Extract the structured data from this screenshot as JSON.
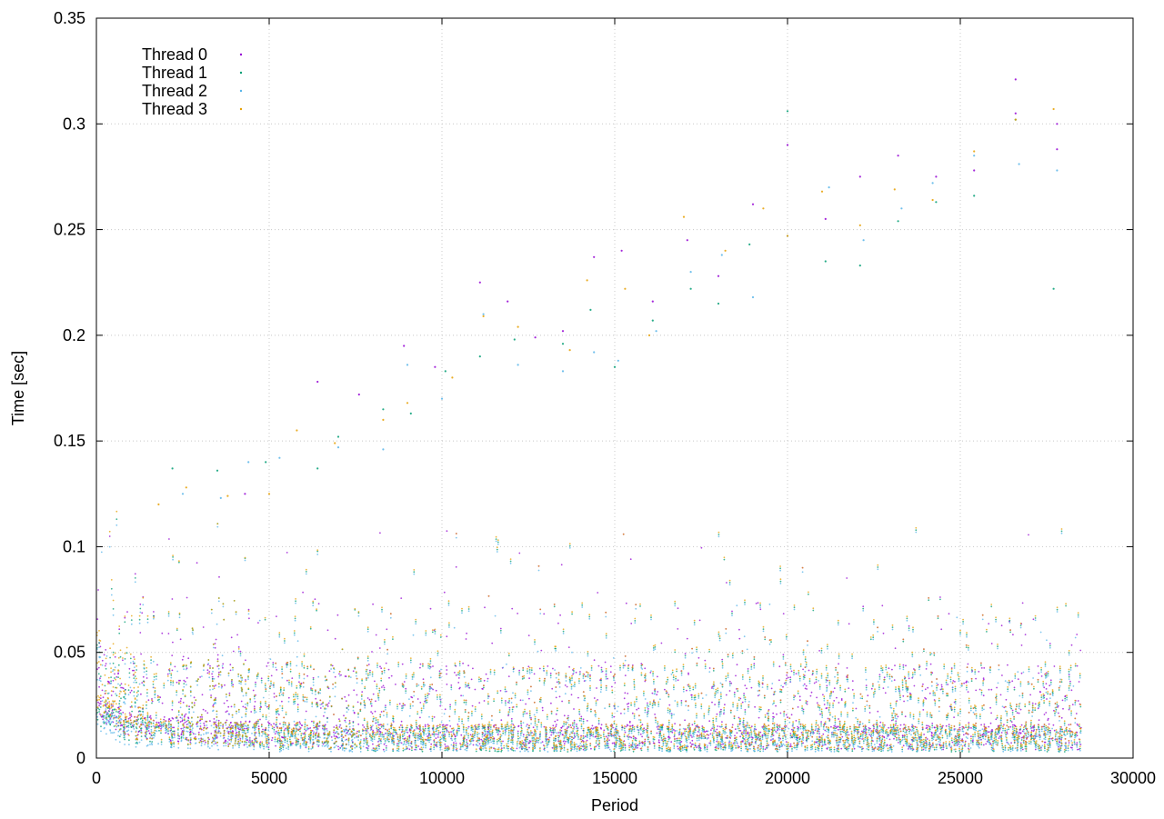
{
  "chart_data": {
    "type": "scatter",
    "title": "",
    "xlabel": "Period",
    "ylabel": "Time [sec]",
    "xlim": [
      0,
      30000
    ],
    "ylim": [
      0,
      0.35
    ],
    "x_ticks": [
      0,
      5000,
      10000,
      15000,
      20000,
      25000,
      30000
    ],
    "y_ticks": [
      0,
      0.05,
      0.1,
      0.15,
      0.2,
      0.25,
      0.3,
      0.35
    ],
    "x_tick_labels": [
      "0",
      "5000",
      "10000",
      "15000",
      "20000",
      "25000",
      "30000"
    ],
    "y_tick_labels": [
      "0",
      "0.05",
      "0.1",
      "0.15",
      "0.2",
      "0.25",
      "0.3",
      "0.35"
    ],
    "grid": true,
    "legend_position": "top-left",
    "series": [
      {
        "name": "Thread 0",
        "color": "#9400d3",
        "marker": "dot",
        "x": [
          0,
          500,
          1000,
          2000,
          3000,
          4000,
          5000,
          6000,
          7000,
          8000,
          9000,
          10000,
          11000,
          12000,
          13000,
          14000,
          15000,
          16000,
          17000,
          18000,
          19000,
          20000,
          21000,
          22000,
          23000,
          24000,
          25000,
          26000,
          27000,
          27800,
          28500
        ],
        "y": [
          0.025,
          0.02,
          0.015,
          0.014,
          0.013,
          0.012,
          0.011,
          0.011,
          0.01,
          0.01,
          0.01,
          0.01,
          0.01,
          0.01,
          0.01,
          0.01,
          0.01,
          0.01,
          0.01,
          0.01,
          0.01,
          0.01,
          0.01,
          0.01,
          0.01,
          0.01,
          0.01,
          0.01,
          0.01,
          0.01,
          0.01
        ],
        "outliers": [
          [
            4300,
            0.125
          ],
          [
            6400,
            0.178
          ],
          [
            7600,
            0.172
          ],
          [
            8900,
            0.195
          ],
          [
            9800,
            0.185
          ],
          [
            11100,
            0.225
          ],
          [
            11900,
            0.216
          ],
          [
            12700,
            0.199
          ],
          [
            13500,
            0.202
          ],
          [
            14400,
            0.237
          ],
          [
            15200,
            0.24
          ],
          [
            16100,
            0.216
          ],
          [
            17100,
            0.245
          ],
          [
            18000,
            0.228
          ],
          [
            19000,
            0.262
          ],
          [
            20000,
            0.29
          ],
          [
            21100,
            0.255
          ],
          [
            22100,
            0.275
          ],
          [
            23200,
            0.285
          ],
          [
            24300,
            0.275
          ],
          [
            25400,
            0.278
          ],
          [
            26600,
            0.321
          ],
          [
            26600,
            0.305
          ],
          [
            27800,
            0.3
          ],
          [
            27800,
            0.288
          ]
        ]
      },
      {
        "name": "Thread 1",
        "color": "#009e73",
        "marker": "dot",
        "x": [
          0,
          500,
          1000,
          2000,
          3000,
          4000,
          5000,
          6000,
          7000,
          8000,
          9000,
          10000,
          11000,
          12000,
          13000,
          14000,
          15000,
          16000,
          17000,
          18000,
          19000,
          20000,
          21000,
          22000,
          23000,
          24000,
          25000,
          26000,
          27000,
          27800,
          28500
        ],
        "y": [
          0.022,
          0.018,
          0.013,
          0.012,
          0.012,
          0.011,
          0.01,
          0.01,
          0.01,
          0.009,
          0.009,
          0.009,
          0.009,
          0.009,
          0.009,
          0.009,
          0.009,
          0.009,
          0.009,
          0.009,
          0.009,
          0.009,
          0.009,
          0.009,
          0.009,
          0.009,
          0.009,
          0.009,
          0.009,
          0.009,
          0.009
        ],
        "outliers": [
          [
            2200,
            0.137
          ],
          [
            3500,
            0.136
          ],
          [
            4900,
            0.14
          ],
          [
            6400,
            0.137
          ],
          [
            7000,
            0.152
          ],
          [
            8300,
            0.165
          ],
          [
            9100,
            0.163
          ],
          [
            10100,
            0.183
          ],
          [
            11100,
            0.19
          ],
          [
            12100,
            0.198
          ],
          [
            13500,
            0.196
          ],
          [
            14300,
            0.212
          ],
          [
            15000,
            0.185
          ],
          [
            16100,
            0.207
          ],
          [
            17200,
            0.222
          ],
          [
            18000,
            0.215
          ],
          [
            18900,
            0.243
          ],
          [
            20000,
            0.306
          ],
          [
            21100,
            0.235
          ],
          [
            22100,
            0.233
          ],
          [
            23200,
            0.254
          ],
          [
            24300,
            0.263
          ],
          [
            25400,
            0.266
          ],
          [
            26600,
            0.302
          ],
          [
            27700,
            0.222
          ]
        ]
      },
      {
        "name": "Thread 2",
        "color": "#56b4e9",
        "marker": "dot",
        "x": [
          0,
          500,
          1000,
          2000,
          3000,
          4000,
          5000,
          6000,
          7000,
          8000,
          9000,
          10000,
          11000,
          12000,
          13000,
          14000,
          15000,
          16000,
          17000,
          18000,
          19000,
          20000,
          21000,
          22000,
          23000,
          24000,
          25000,
          26000,
          27000,
          27800,
          28500
        ],
        "y": [
          0.02,
          0.015,
          0.011,
          0.011,
          0.01,
          0.01,
          0.009,
          0.009,
          0.008,
          0.008,
          0.008,
          0.008,
          0.008,
          0.008,
          0.008,
          0.008,
          0.008,
          0.008,
          0.008,
          0.008,
          0.008,
          0.008,
          0.008,
          0.008,
          0.008,
          0.008,
          0.008,
          0.008,
          0.008,
          0.008,
          0.008
        ],
        "outliers": [
          [
            2500,
            0.125
          ],
          [
            3600,
            0.123
          ],
          [
            4400,
            0.14
          ],
          [
            5300,
            0.142
          ],
          [
            7000,
            0.147
          ],
          [
            8300,
            0.146
          ],
          [
            9000,
            0.186
          ],
          [
            10000,
            0.17
          ],
          [
            11200,
            0.21
          ],
          [
            12200,
            0.186
          ],
          [
            13500,
            0.183
          ],
          [
            14400,
            0.192
          ],
          [
            15100,
            0.188
          ],
          [
            16200,
            0.202
          ],
          [
            17200,
            0.23
          ],
          [
            18100,
            0.238
          ],
          [
            19000,
            0.218
          ],
          [
            20000,
            0.247
          ],
          [
            21200,
            0.27
          ],
          [
            22200,
            0.245
          ],
          [
            23300,
            0.26
          ],
          [
            24200,
            0.272
          ],
          [
            25400,
            0.285
          ],
          [
            26700,
            0.281
          ],
          [
            27800,
            0.278
          ]
        ]
      },
      {
        "name": "Thread 3",
        "color": "#e69f00",
        "marker": "dot",
        "x": [
          0,
          500,
          1000,
          2000,
          3000,
          4000,
          5000,
          6000,
          7000,
          8000,
          9000,
          10000,
          11000,
          12000,
          13000,
          14000,
          15000,
          16000,
          17000,
          18000,
          19000,
          20000,
          21000,
          22000,
          23000,
          24000,
          25000,
          26000,
          27000,
          27800,
          28500
        ],
        "y": [
          0.028,
          0.022,
          0.015,
          0.013,
          0.012,
          0.011,
          0.011,
          0.011,
          0.01,
          0.01,
          0.01,
          0.01,
          0.01,
          0.01,
          0.01,
          0.01,
          0.01,
          0.01,
          0.01,
          0.01,
          0.01,
          0.01,
          0.01,
          0.01,
          0.01,
          0.01,
          0.01,
          0.01,
          0.01,
          0.01,
          0.01
        ],
        "outliers": [
          [
            1800,
            0.12
          ],
          [
            2600,
            0.128
          ],
          [
            3800,
            0.124
          ],
          [
            5000,
            0.125
          ],
          [
            5800,
            0.155
          ],
          [
            6900,
            0.149
          ],
          [
            8300,
            0.16
          ],
          [
            9000,
            0.168
          ],
          [
            10300,
            0.18
          ],
          [
            11200,
            0.209
          ],
          [
            12200,
            0.204
          ],
          [
            13700,
            0.193
          ],
          [
            14200,
            0.226
          ],
          [
            15300,
            0.222
          ],
          [
            16000,
            0.2
          ],
          [
            17000,
            0.256
          ],
          [
            18200,
            0.24
          ],
          [
            19300,
            0.26
          ],
          [
            20000,
            0.247
          ],
          [
            21000,
            0.268
          ],
          [
            22100,
            0.252
          ],
          [
            23100,
            0.269
          ],
          [
            24200,
            0.264
          ],
          [
            25400,
            0.287
          ],
          [
            26600,
            0.302
          ],
          [
            27700,
            0.307
          ]
        ]
      }
    ]
  }
}
